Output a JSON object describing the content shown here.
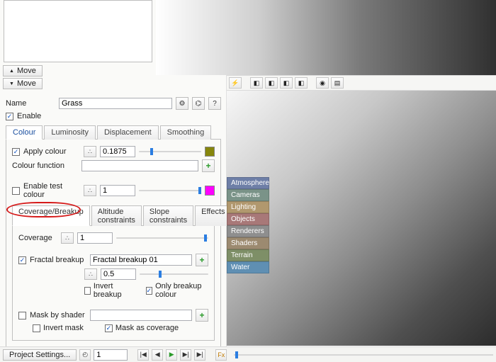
{
  "topButtons": {
    "moveUp": "Move",
    "moveDown": "Move"
  },
  "nameRow": {
    "label": "Name",
    "value": "Grass",
    "enableLabel": "Enable",
    "enableChecked": true
  },
  "tabs": [
    "Colour",
    "Luminosity",
    "Displacement",
    "Smoothing"
  ],
  "activeTab": 0,
  "colourPanel": {
    "applyColour": {
      "label": "Apply colour",
      "checked": true,
      "value": "0.1875",
      "swatch": "#86860c"
    },
    "colourFunction": {
      "label": "Colour function",
      "value": ""
    },
    "enableTestColour": {
      "label": "Enable test colour",
      "checked": false,
      "value": "1",
      "swatch": "#ff00ff"
    }
  },
  "subtabs": [
    "Coverage/Breakup",
    "Altitude constraints",
    "Slope constraints",
    "Effects"
  ],
  "activeSubtab": 0,
  "coveragePanel": {
    "coverage": {
      "label": "Coverage",
      "value": "1"
    },
    "fractalBreakup": {
      "checkboxLabel": "Fractal breakup",
      "checked": true,
      "shaderName": "Fractal breakup 01",
      "value": "0.5",
      "invertLabel": "Invert breakup",
      "invertChecked": false,
      "onlyLabel": "Only breakup colour",
      "onlyChecked": true
    },
    "maskByShader": {
      "label": "Mask by shader",
      "checked": false,
      "shaderValue": "",
      "invertLabel": "Invert mask",
      "invertChecked": false,
      "maskAsCoverageLabel": "Mask as coverage",
      "maskAsCoverageChecked": true
    }
  },
  "sideTabs": [
    "Atmosphere",
    "Cameras",
    "Lighting",
    "Objects",
    "Renderers",
    "Shaders",
    "Terrain",
    "Water"
  ],
  "bottom": {
    "projectSettings": "Project Settings...",
    "frame": "1"
  },
  "icons": {
    "gear": "⚙",
    "tree": "⌬",
    "help": "?",
    "picker": "∴",
    "plus": "+",
    "bolt": "⚡",
    "clock": "◴",
    "skipFirst": "|◀",
    "stepBack": "◀",
    "play": "▶",
    "stepFwd": "▶|",
    "skipLast": "▶|",
    "fx": "Fx"
  }
}
